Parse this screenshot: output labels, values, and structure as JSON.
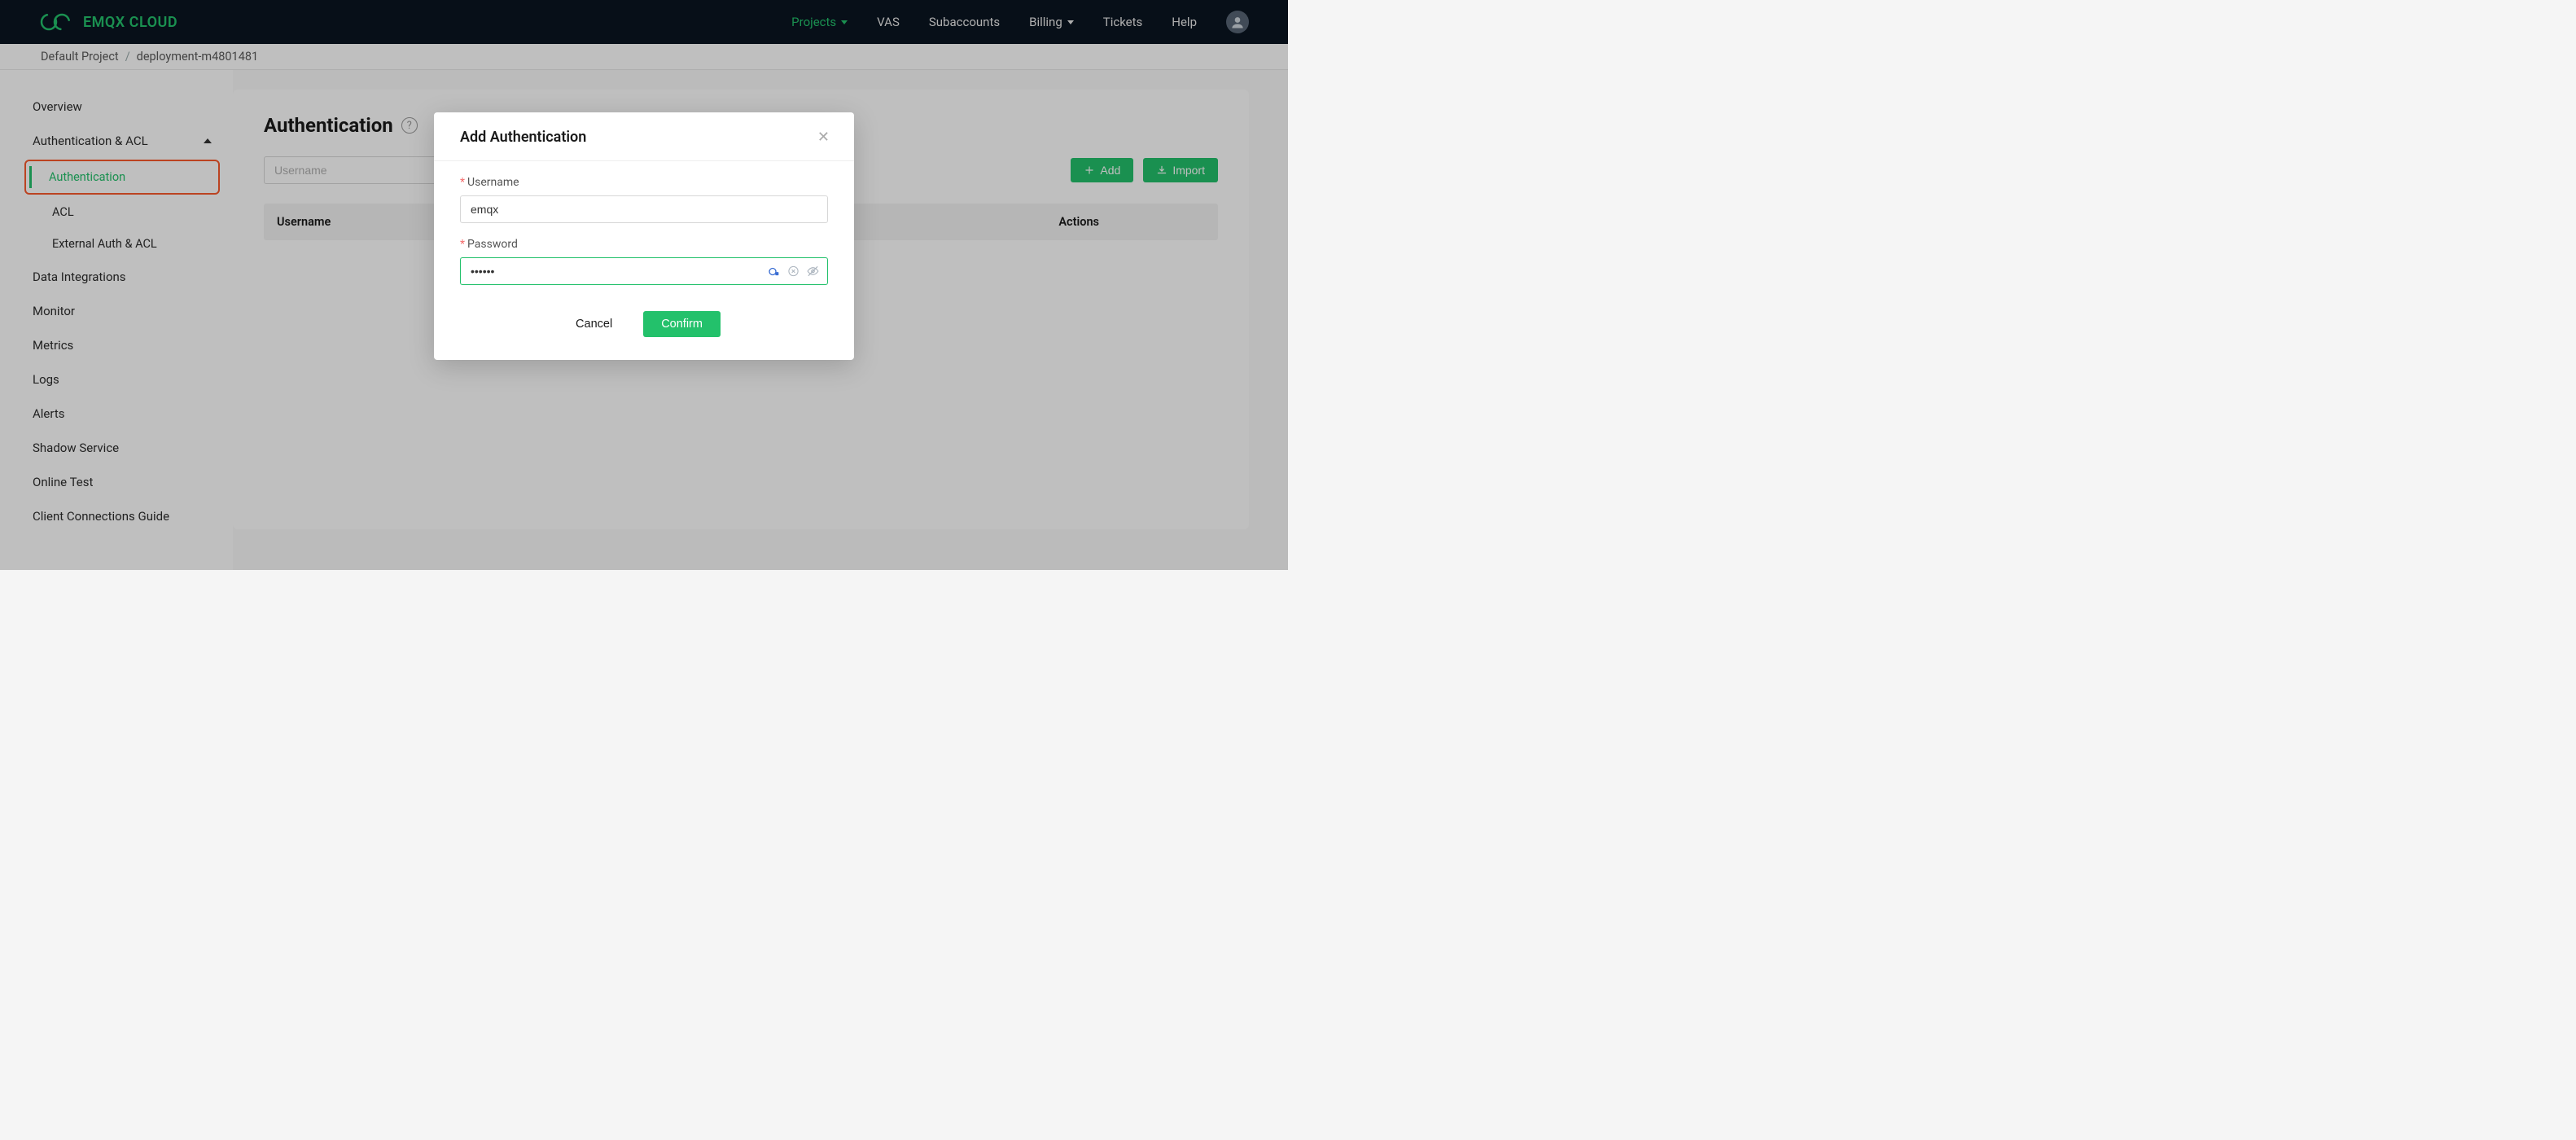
{
  "brand": "EMQX CLOUD",
  "nav": {
    "projects": "Projects",
    "vas": "VAS",
    "subaccounts": "Subaccounts",
    "billing": "Billing",
    "tickets": "Tickets",
    "help": "Help"
  },
  "breadcrumb": {
    "root": "Default Project",
    "current": "deployment-m4801481"
  },
  "sidebar": {
    "overview": "Overview",
    "auth_acl": "Authentication & ACL",
    "sub": {
      "authentication": "Authentication",
      "acl": "ACL",
      "external": "External Auth & ACL"
    },
    "data_integrations": "Data Integrations",
    "monitor": "Monitor",
    "metrics": "Metrics",
    "logs": "Logs",
    "alerts": "Alerts",
    "shadow_service": "Shadow Service",
    "online_test": "Online Test",
    "client_connections": "Client Connections Guide"
  },
  "page": {
    "title": "Authentication",
    "search_placeholder": "Username",
    "add_label": "Add",
    "import_label": "Import",
    "columns": {
      "username": "Username",
      "actions": "Actions"
    }
  },
  "modal": {
    "title": "Add Authentication",
    "username_label": "Username",
    "username_value": "emqx",
    "password_label": "Password",
    "password_value": "••••••",
    "cancel": "Cancel",
    "confirm": "Confirm"
  }
}
